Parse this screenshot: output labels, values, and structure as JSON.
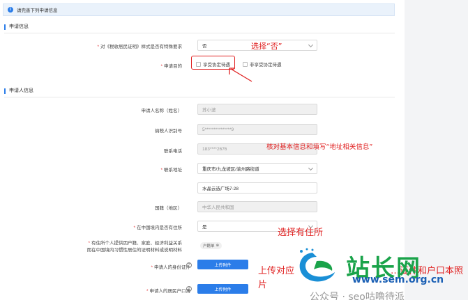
{
  "notice": {
    "text": "请完善下列申请信息"
  },
  "sections": {
    "application": "申请信息",
    "applicant": "申请人信息"
  },
  "application": {
    "special_label": "对《税收居民证明》样式是否有特殊要求",
    "special_value": "否",
    "purpose_label": "申请目的",
    "purpose_options": [
      "享受协定待遇",
      "非享受协定待遇"
    ]
  },
  "applicant": {
    "name_label": "申请人名称（姓名）",
    "name_value": "苏小波",
    "taxid_label": "纳税人识别号",
    "taxid_value": "5***************9",
    "phone_label": "联系电话",
    "phone_value": "183****2676",
    "address_label": "联系地址",
    "address_region": "重庆市/九龙坡区/渝州路街道",
    "address_detail": "水晶云选广场7-28",
    "nationality_label": "国籍（地区）",
    "nationality_value": "中华人民共和国",
    "residence_label": "在中国境内是否有住所",
    "residence_value": "是",
    "proof_label_1": "有住所个人提供因户籍、家庭、经济利益关系",
    "proof_label_2": "而在中国境内习惯性居住的证明材料或说明材料",
    "proof_tag": "户籍单",
    "id_label": "申请人的身份证件",
    "hukou_label": "申请人的居民户口簿",
    "upload_label": "上传附件",
    "help_glyph": "?"
  },
  "annotations": {
    "select_no": "选择“否”",
    "verify": "核对基本信息和填写“地址相关信息”",
    "select_residence": "选择有住所",
    "upload_line1": "上传对应",
    "upload_line1b": "…证件和户口本照",
    "upload_line2": "片"
  },
  "watermark": {
    "logo_text": "站长网",
    "url": "www.sem.org.cn",
    "wechat": "公众号 · seo咕噜待派"
  },
  "colors": {
    "accent": "#2b7de9",
    "annotation": "#e02020",
    "logo_green": "#1aa34a"
  }
}
